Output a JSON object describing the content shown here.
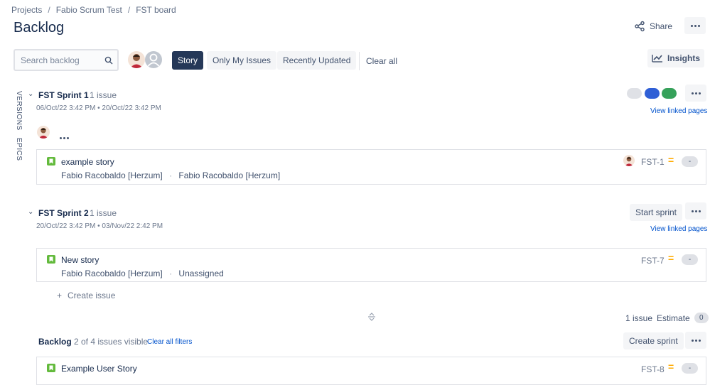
{
  "breadcrumb": [
    "Projects",
    "Fabio Scrum Test",
    "FST board"
  ],
  "page": {
    "title": "Backlog",
    "share_label": "Share"
  },
  "filters": {
    "search_placeholder": "Search backlog",
    "story": "Story",
    "only_my_issues": "Only My Issues",
    "recently_updated": "Recently Updated",
    "clear_all": "Clear all",
    "insights": "Insights"
  },
  "side_tabs": [
    "VERSIONS",
    "EPICS"
  ],
  "colors": {
    "story_icon": "#63ba3c",
    "priority_medium": "#ffab00",
    "active_filter": "#253858",
    "link": "#0052cc"
  },
  "sprints": [
    {
      "name": "FST Sprint 1",
      "count": "1 issue",
      "dates": "06/Oct/22 3:42 PM • 20/Oct/22 3:42 PM",
      "link": "View linked pages",
      "status_colors": [
        "#dfe1e6",
        "#2f5fd6",
        "#36a15a"
      ],
      "issues": [
        {
          "title": "example story",
          "reporter": "Fabio Racobaldo [Herzum]",
          "sep": "·",
          "assignee": "Fabio Racobaldo [Herzum]",
          "key": "FST-1",
          "estimate": "-"
        }
      ]
    },
    {
      "name": "FST Sprint 2",
      "count": "1 issue",
      "dates": "20/Oct/22 3:42 PM • 03/Nov/22 2:42 PM",
      "link": "View linked pages",
      "action": "Start sprint",
      "create_issue": "Create issue",
      "footer_count": "1 issue",
      "footer_estimate_label": "Estimate",
      "footer_estimate_value": "0",
      "issues": [
        {
          "title": "New story",
          "reporter": "Fabio Racobaldo [Herzum]",
          "sep": "·",
          "assignee": "Unassigned",
          "key": "FST-7",
          "estimate": "-"
        }
      ]
    }
  ],
  "backlog": {
    "title": "Backlog",
    "visible": "2 of 4 issues visible",
    "clear_filters": "Clear all filters",
    "create_sprint": "Create sprint",
    "issues": [
      {
        "title": "Example User Story",
        "key": "FST-8",
        "estimate": "-"
      }
    ]
  }
}
